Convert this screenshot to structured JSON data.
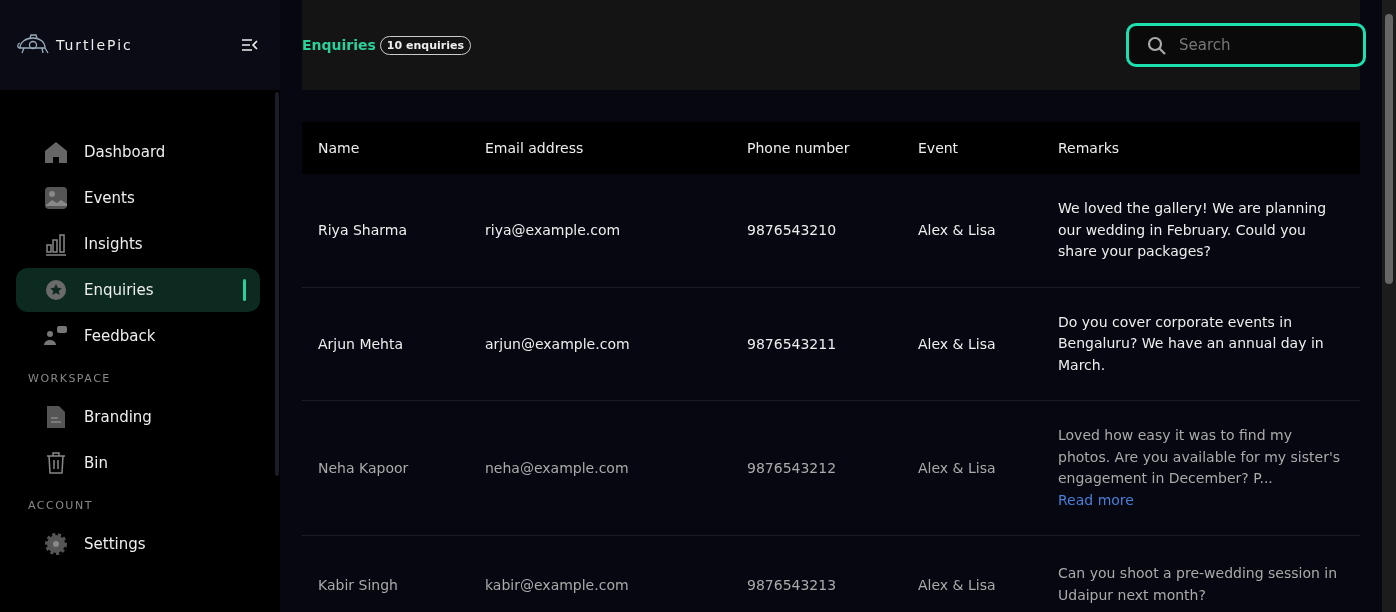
{
  "brand": {
    "name": "TurtlePic"
  },
  "sidebar": {
    "groups": [
      {
        "items": [
          {
            "label": "Dashboard",
            "kind": "home",
            "selected": false
          },
          {
            "label": "Events",
            "kind": "image",
            "selected": false
          },
          {
            "label": "Insights",
            "kind": "chart",
            "selected": false
          },
          {
            "label": "Enquiries",
            "kind": "star",
            "selected": true
          },
          {
            "label": "Feedback",
            "kind": "people",
            "selected": false
          }
        ]
      },
      {
        "heading": "WORKSPACE",
        "items": [
          {
            "label": "Branding",
            "kind": "doc",
            "selected": false
          },
          {
            "label": "Bin",
            "kind": "trash",
            "selected": false
          }
        ]
      },
      {
        "heading": "ACCOUNT",
        "items": [
          {
            "label": "Settings",
            "kind": "gear",
            "selected": false
          }
        ]
      }
    ]
  },
  "header": {
    "title": "Enquiries",
    "badge": "10 enquiries",
    "search": {
      "placeholder": "Search"
    }
  },
  "table": {
    "columns": [
      "Name",
      "Email address",
      "Phone number",
      "Event",
      "Remarks"
    ],
    "rows": [
      {
        "unread": true,
        "cells": [
          "Riya Sharma",
          "riya@example.com",
          "9876543210",
          "Alex & Lisa",
          "We loved the gallery! We are planning our wedding in February. Could you share your packages?"
        ]
      },
      {
        "unread": true,
        "cells": [
          "Arjun Mehta",
          "arjun@example.com",
          "9876543211",
          "Alex & Lisa",
          "Do you cover corporate events in Bengaluru? We have an annual day in March."
        ]
      },
      {
        "unread": false,
        "cells": [
          "Neha Kapoor",
          "neha@example.com",
          "9876543212",
          "Alex & Lisa",
          "Loved how easy it was to find my photos. Are you available for my sister's engagement in December? P..."
        ],
        "link": "Read more"
      },
      {
        "unread": false,
        "cells": [
          "Kabir Singh",
          "kabir@example.com",
          "9876543213",
          "Alex & Lisa",
          "Can you shoot a pre-wedding session in Udaipur next month?"
        ]
      }
    ]
  }
}
